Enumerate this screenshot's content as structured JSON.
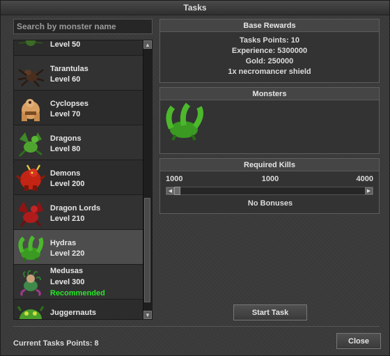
{
  "window": {
    "title": "Tasks"
  },
  "search": {
    "placeholder": "Search by monster name"
  },
  "monsters": [
    {
      "name": "",
      "level": "Level 50",
      "recommended": "",
      "icon": "spider-icon"
    },
    {
      "name": "Tarantulas",
      "level": "Level 60",
      "recommended": "",
      "icon": "tarantula-icon"
    },
    {
      "name": "Cyclopses",
      "level": "Level 70",
      "recommended": "",
      "icon": "cyclops-icon"
    },
    {
      "name": "Dragons",
      "level": "Level 80",
      "recommended": "",
      "icon": "dragon-icon"
    },
    {
      "name": "Demons",
      "level": "Level 200",
      "recommended": "",
      "icon": "demon-icon"
    },
    {
      "name": "Dragon Lords",
      "level": "Level 210",
      "recommended": "",
      "icon": "dragon-lord-icon"
    },
    {
      "name": "Hydras",
      "level": "Level 220",
      "recommended": "",
      "icon": "hydra-icon"
    },
    {
      "name": "Medusas",
      "level": "Level 300",
      "recommended": "Recommended",
      "icon": "medusa-icon"
    },
    {
      "name": "Juggernauts",
      "level": "",
      "recommended": "",
      "icon": "juggernaut-icon"
    }
  ],
  "base_rewards": {
    "title": "Base Rewards",
    "task_points": "Tasks Points: 10",
    "experience": "Experience: 5300000",
    "gold": "Gold: 250000",
    "item": "1x necromancer shield"
  },
  "monsters_panel": {
    "title": "Monsters",
    "icon": "hydra-icon"
  },
  "required_kills": {
    "title": "Required Kills",
    "min": "1000",
    "current": "1000",
    "max": "4000",
    "value": 1000,
    "bonus_text": "No Bonuses"
  },
  "actions": {
    "start_task": "Start Task",
    "close": "Close"
  },
  "footer": {
    "current_points": "Current Tasks Points: 8"
  },
  "colors": {
    "recommended": "#29e629",
    "background": "#3a3a3a"
  }
}
